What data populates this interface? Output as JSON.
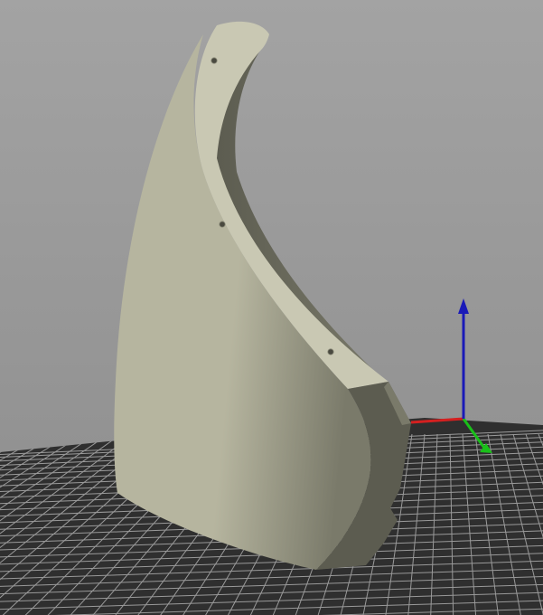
{
  "viewport": {
    "background_top": "#a3a3a3",
    "background_bottom": "#8c8c8c"
  },
  "bed": {
    "plate_color": "#2f2f2f",
    "grid_color": "#9a9a9a"
  },
  "model": {
    "top_face_color": "#c9c8b3",
    "lit_side_color": "#b6b59f",
    "shade_color": "#7a7a6a",
    "dark_side_color": "#5c5c50",
    "mount_holes": 3
  },
  "axes": {
    "x_color": "#d42020",
    "y_color": "#19c019",
    "z_color": "#1a1ab8"
  }
}
